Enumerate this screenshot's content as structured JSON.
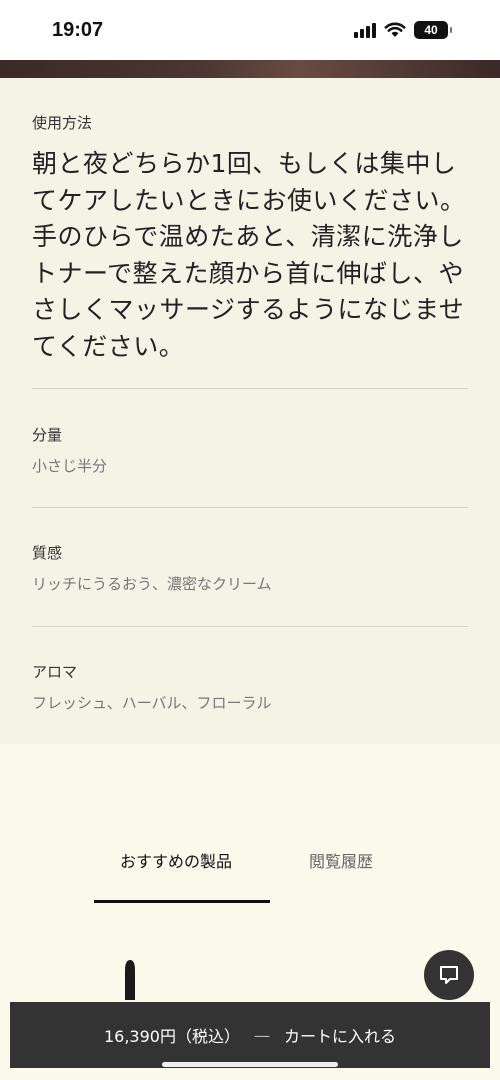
{
  "status_bar": {
    "time": "19:07",
    "battery": "40"
  },
  "usage": {
    "label": "使用方法",
    "text": "朝と夜どちらか1回、もしくは集中してケアしたいときにお使いください。手のひらで温めたあと、清潔に洗浄しトナーで整えた顔から首に伸ばし、やさしくマッサージするようになじませてください。"
  },
  "details": [
    {
      "title": "分量",
      "value": "小さじ半分"
    },
    {
      "title": "質感",
      "value": "リッチにうるおう、濃密なクリーム"
    },
    {
      "title": "アロマ",
      "value": "フレッシュ、ハーバル、フローラル"
    }
  ],
  "tabs": {
    "recommended": "おすすめの製品",
    "history": "閲覧履歴"
  },
  "cart": {
    "price": "16,390円（税込）",
    "separator": "—",
    "action": "カートに入れる"
  },
  "icons": {
    "chat": "chat-bubble-icon",
    "signal": "cellular-signal-icon",
    "wifi": "wifi-icon",
    "battery": "battery-icon"
  },
  "colors": {
    "panel_bg": "#f5f2e6",
    "page_bg": "#fbf8ec",
    "cart_bg": "#333333"
  }
}
